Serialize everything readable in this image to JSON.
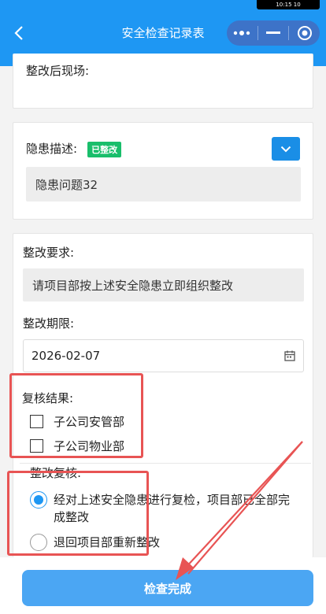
{
  "header": {
    "title": "安全检查记录表",
    "status_pill": "10:15 10"
  },
  "after_rectification": {
    "label": "整改后现场:"
  },
  "hazard": {
    "label": "隐患描述:",
    "badge": "已整改",
    "description": "隐患问题32"
  },
  "requirements": {
    "label": "整改要求:",
    "value": "请项目部按上述安全隐患立即组织整改",
    "deadline_label": "整改期限:",
    "deadline_value": "2026-02-07"
  },
  "review": {
    "label": "复核结果:",
    "options": [
      {
        "label": "子公司安管部",
        "checked": false
      },
      {
        "label": "子公司物业部",
        "checked": false
      }
    ]
  },
  "recheck": {
    "label": "整改复核:",
    "options": [
      {
        "label": "经对上述安全隐患进行复检，项目部已全部完成整改",
        "selected": true
      },
      {
        "label": "退回项目部重新整改",
        "selected": false
      }
    ]
  },
  "footer": {
    "submit_label": "检查完成"
  },
  "colors": {
    "primary": "#1e97f3",
    "badge_green": "#19be6b",
    "annotation_red": "#e85454"
  },
  "icons": [
    "back-arrow-icon",
    "more-dots-icon",
    "minimize-icon",
    "target-icon",
    "chevron-down-icon",
    "calendar-icon"
  ]
}
